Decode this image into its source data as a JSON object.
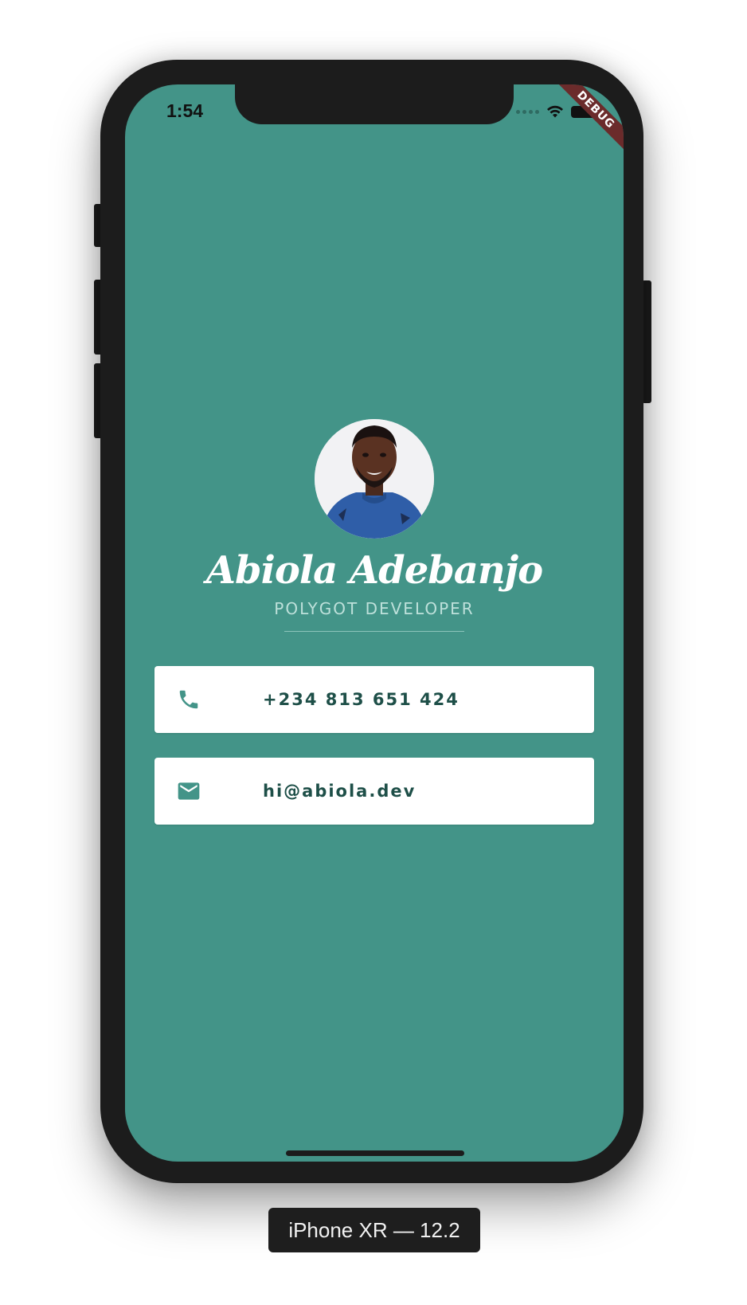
{
  "status_bar": {
    "time": "1:54",
    "debug_banner": "DEBUG"
  },
  "profile": {
    "name": "Abiola Adebanjo",
    "title": "POLYGOT DEVELOPER"
  },
  "contacts": {
    "phone": "+234 813 651 424",
    "email": "hi@abiola.dev"
  },
  "device_label": "iPhone XR — 12.2",
  "colors": {
    "background": "#439488",
    "card": "#ffffff",
    "text_dark": "#1e4f48",
    "icon": "#439488",
    "subtitle": "#bde0da"
  }
}
